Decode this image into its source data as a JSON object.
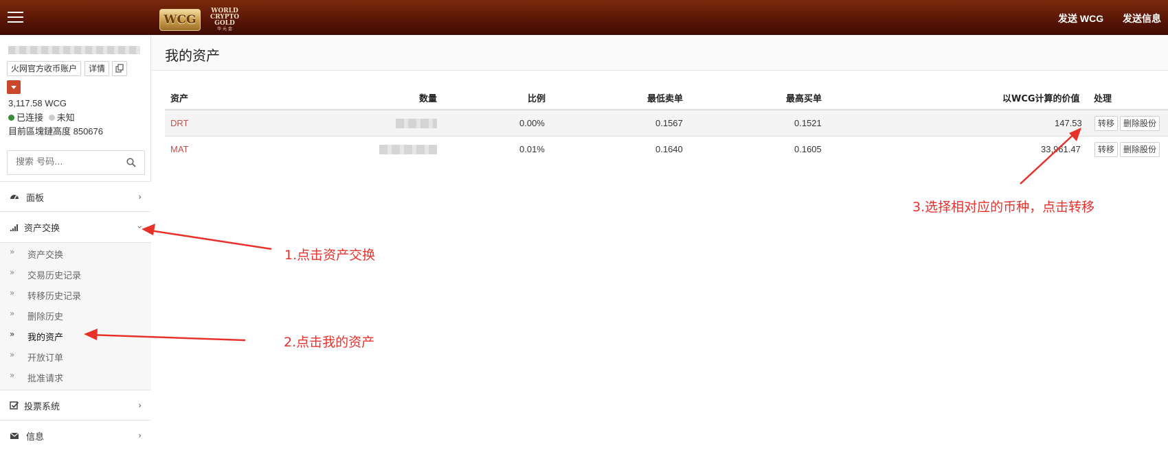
{
  "topbar": {
    "logo_badge": "WCG",
    "logo_lines": [
      "WORLD",
      "CRYPTO",
      "GOLD"
    ],
    "logo_subline": "华 元 金",
    "send_wcg": "发送 WCG",
    "send_message": "发送信息",
    "bar_color": "#5a1606"
  },
  "sidebar": {
    "account_tag": "火网官方收币账户",
    "details_button": "详情",
    "balance": "3,117.58 WCG",
    "status_connected": "已连接",
    "status_unknown": "未知",
    "block_height": "目前區塊鏈高度 850676",
    "search_placeholder": "搜索 号码...",
    "nav": {
      "dashboard": "面板",
      "asset_exchange": "资产交换",
      "voting": "投票系统",
      "messages": "信息"
    },
    "sub_items": [
      "资产交换",
      "交易历史记录",
      "转移历史记录",
      "删除历史",
      "我的资产",
      "开放订单",
      "批准请求"
    ],
    "status_colors": {
      "connected": "#3c8a3c",
      "unknown": "#cccccc"
    }
  },
  "main": {
    "title": "我的资产",
    "columns": {
      "asset": "资产",
      "quantity": "数量",
      "ratio": "比例",
      "lowest_ask": "最低卖单",
      "highest_bid": "最高买单",
      "value_wcg": "以WCG计算的价值",
      "action": "处理"
    },
    "rows": [
      {
        "asset": "DRT",
        "ratio": "0.00%",
        "lowest_ask": "0.1567",
        "highest_bid": "0.1521",
        "value": "147.53",
        "transfer": "转移",
        "delete": "删除股份"
      },
      {
        "asset": "MAT",
        "ratio": "0.01%",
        "lowest_ask": "0.1640",
        "highest_bid": "0.1605",
        "value": "33,961.47",
        "transfer": "转移",
        "delete": "删除股份"
      }
    ]
  },
  "annotations": {
    "step1": "1.点击资产交换",
    "step2": "2.点击我的资产",
    "step3": "3.选择相对应的币种，点击转移",
    "color": "#e8312b"
  }
}
